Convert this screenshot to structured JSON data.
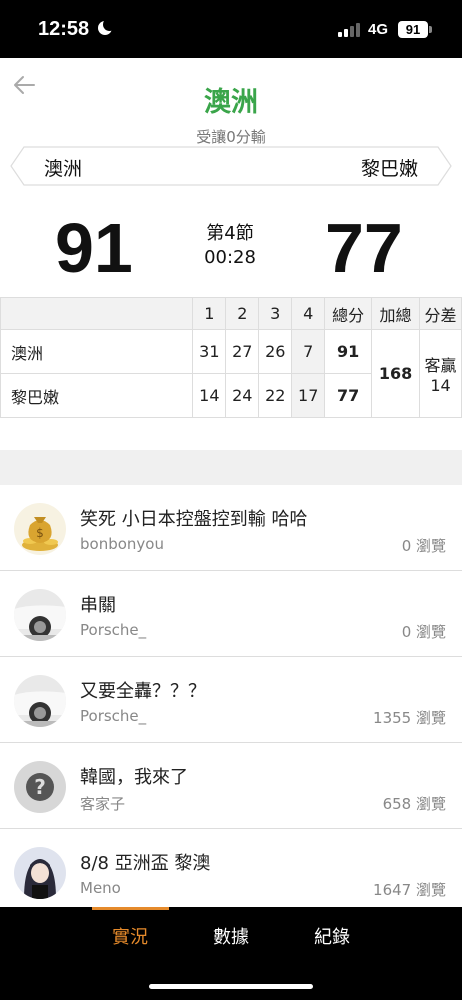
{
  "status_bar": {
    "time": "12:58",
    "network": "4G",
    "battery": "91"
  },
  "header": {
    "title": "澳洲",
    "handicap": "受讓0分輸",
    "home_team": "澳洲",
    "away_team": "黎巴嫩"
  },
  "scoreboard": {
    "home_score": "91",
    "away_score": "77",
    "period": "第4節",
    "clock": "00:28"
  },
  "score_table": {
    "headers": [
      "1",
      "2",
      "3",
      "4",
      "總分",
      "加總",
      "分差"
    ],
    "rows": [
      {
        "team": "澳洲",
        "q1": "31",
        "q2": "27",
        "q3": "26",
        "q4": "7",
        "total": "91"
      },
      {
        "team": "黎巴嫩",
        "q1": "14",
        "q2": "24",
        "q3": "22",
        "q4": "17",
        "total": "77"
      }
    ],
    "sum": "168",
    "diff_label": "客贏",
    "diff_value": "14"
  },
  "posts": [
    {
      "title": "笑死 小日本控盤控到輸 哈哈",
      "user": "bonbonyou",
      "views": "0 瀏覽",
      "avatar": "money-bag-icon"
    },
    {
      "title": "串關",
      "user": "Porsche_",
      "views": "0 瀏覽",
      "avatar": "car-photo"
    },
    {
      "title": "又要全轟？？？",
      "user": "Porsche_",
      "views": "1355 瀏覽",
      "avatar": "car-photo"
    },
    {
      "title": "韓國，我來了",
      "user": "客家子",
      "views": "658 瀏覽",
      "avatar": "question-mark-icon"
    },
    {
      "title": "8/8 亞洲盃 黎澳",
      "user": "Meno",
      "views": "1647 瀏覽",
      "avatar": "anime-girl-photo"
    }
  ],
  "tabs": [
    {
      "label": "實況",
      "active": true
    },
    {
      "label": "數據",
      "active": false
    },
    {
      "label": "紀錄",
      "active": false
    }
  ],
  "colors": {
    "accent_green": "#3aa54a",
    "active_tab": "#e58a2b"
  }
}
